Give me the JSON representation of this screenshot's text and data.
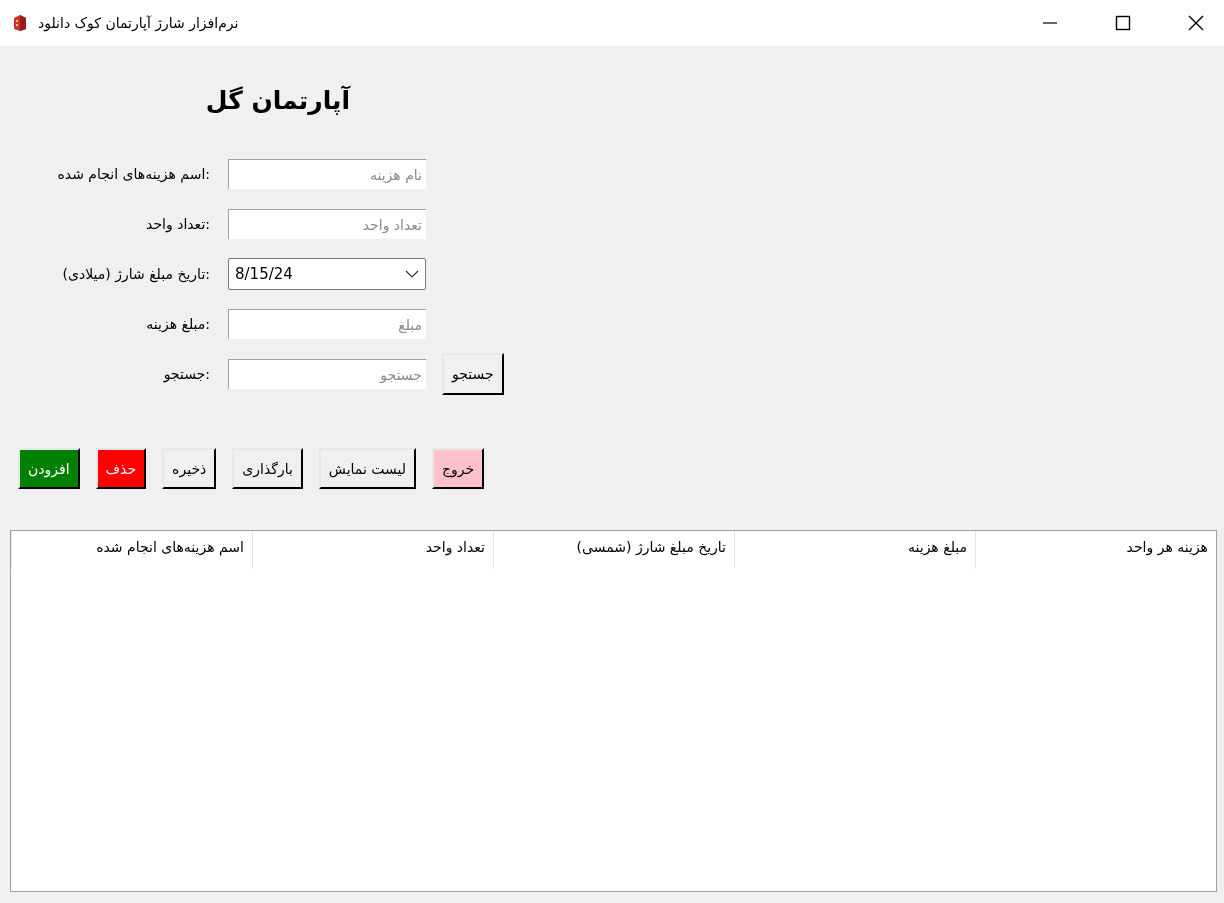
{
  "window": {
    "title": "نرم‌افزار شارژ آپارتمان کوک دانلود"
  },
  "heading": "آپارتمان گل",
  "fields": [
    {
      "label": ":اسم هزینه‌های انجام شده",
      "kind": "text",
      "placeholder": "نام هزینه"
    },
    {
      "label": ":تعداد واحد",
      "kind": "text",
      "placeholder": "تعداد واحد"
    },
    {
      "label": ":تاریخ مبلغ شارژ (میلادی)",
      "kind": "date",
      "value": "8/15/24"
    },
    {
      "label": ":مبلغ هزینه",
      "kind": "text",
      "placeholder": "مبلغ"
    }
  ],
  "search": {
    "label": ":جستجو",
    "placeholder": "جستجو",
    "button": "جستجو"
  },
  "buttons": [
    {
      "label": "خروج",
      "color": "#ffc0cb"
    },
    {
      "label": "لیست نمایش",
      "color": "#f0f0f0"
    },
    {
      "label": "بارگذاری",
      "color": "#f0f0f0"
    },
    {
      "label": "ذخیره",
      "color": "#f0f0f0"
    },
    {
      "label": "حذف",
      "color": "#ff0000"
    },
    {
      "label": "افزودن",
      "color": "#008000"
    }
  ],
  "table": {
    "columns": [
      "هزینه هر واحد",
      "مبلغ هزینه",
      "تاریخ مبلغ شارژ (شمسی)",
      "تعداد واحد",
      "اسم هزینه‌های انجام شده"
    ]
  }
}
